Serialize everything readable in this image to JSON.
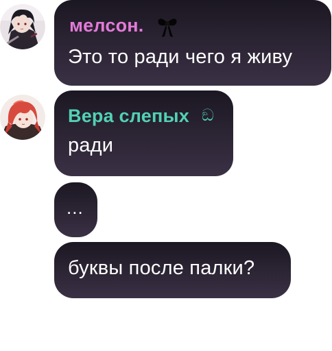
{
  "colors": {
    "bubble_bg": "#2a2332",
    "author_1": "#e27ad8",
    "author_2": "#52d1b5",
    "message_text": "#ffffff"
  },
  "messages": [
    {
      "author": "мелсон.",
      "author_decoration_icon": "black-bow-icon",
      "text": "Это то ради чего я живу",
      "avatar_icon": "dark-haired-character-avatar"
    },
    {
      "author": "Вера слепых",
      "author_badge": "ඞ",
      "text": "ради",
      "avatar_icon": "red-haired-character-avatar"
    },
    {
      "text": "..."
    },
    {
      "text": "буквы после палки?"
    }
  ]
}
